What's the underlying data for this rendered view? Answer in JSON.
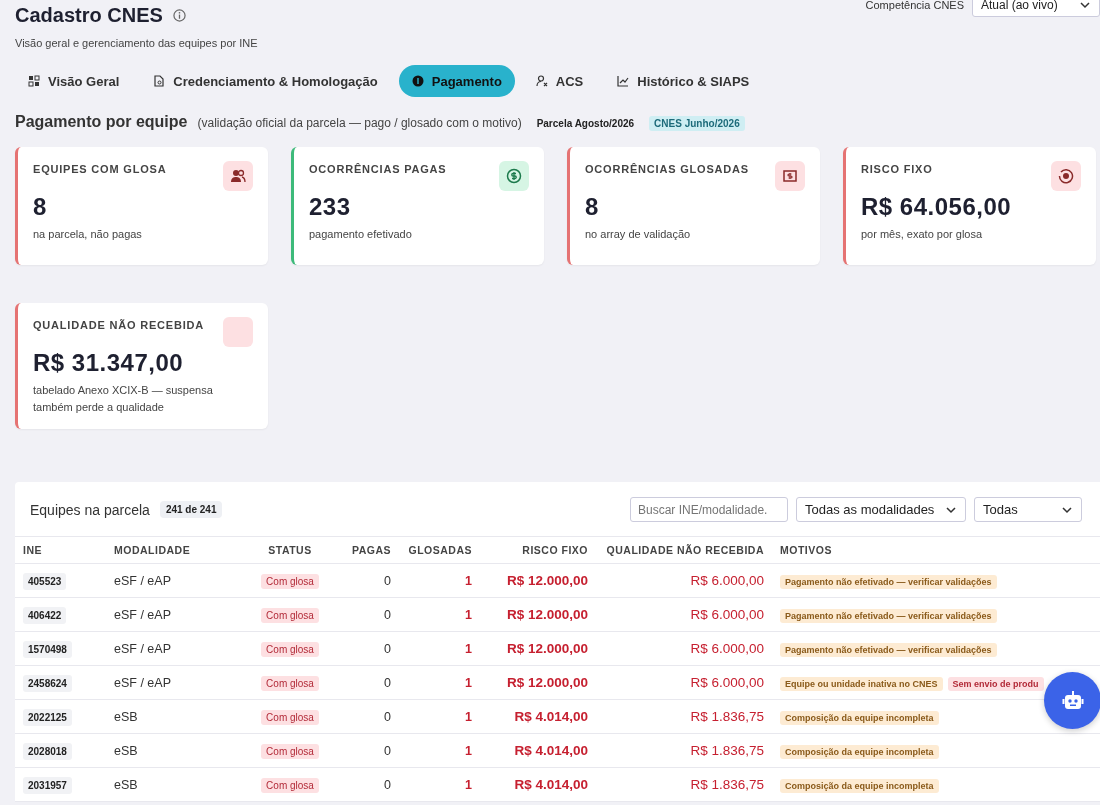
{
  "header": {
    "title": "Cadastro CNES",
    "subtitle": "Visão geral e gerenciamento das equipes por INE",
    "competencia_label": "Competência CNES",
    "competencia_value": "Atual (ao vivo)"
  },
  "tabs": [
    {
      "label": "Visão Geral",
      "selected": false
    },
    {
      "label": "Credenciamento & Homologação",
      "selected": false
    },
    {
      "label": "Pagamento",
      "selected": true
    },
    {
      "label": "ACS",
      "selected": false
    },
    {
      "label": "Histórico & SIAPS",
      "selected": false
    }
  ],
  "section": {
    "title": "Pagamento por equipe",
    "note": "(validação oficial da parcela — pago / glosado com o motivo)",
    "badges": [
      {
        "text": "Parcela Agosto/2026",
        "kind": "plain"
      },
      {
        "text": "CNES Junho/2026",
        "kind": "info"
      }
    ]
  },
  "cards": [
    {
      "label": "EQUIPES COM GLOSA",
      "value": "8",
      "caption": "na parcela, não pagas",
      "kind": "danger"
    },
    {
      "label": "OCORRÊNCIAS PAGAS",
      "value": "233",
      "caption": "pagamento efetivado",
      "kind": "success"
    },
    {
      "label": "OCORRÊNCIAS GLOSADAS",
      "value": "8",
      "caption": "no array de validação",
      "kind": "danger"
    },
    {
      "label": "RISCO FIXO",
      "value": "R$ 64.056,00",
      "caption": "por mês, exato por glosa",
      "kind": "danger"
    },
    {
      "label": "QUALIDADE NÃO RECEBIDA",
      "value": "R$ 31.347,00",
      "caption": "tabelado Anexo XCIX-B — suspensa também perde a qualidade",
      "kind": "danger"
    }
  ],
  "table": {
    "title": "Equipes na parcela",
    "count": "241 de 241",
    "search": {
      "placeholder": "Buscar INE/modalidade."
    },
    "filters": [
      "Todas as modalidades",
      "Todas"
    ],
    "columns": [
      "INE",
      "MODALIDADE",
      "STATUS",
      "PAGAS",
      "GLOSADAS",
      "RISCO FIXO",
      "QUALIDADE NÃO RECEBIDA",
      "MOTIVOS"
    ],
    "rows": [
      {
        "ine": "405523",
        "modalidade": "eSF / eAP",
        "status": "Com glosa",
        "pagas": "0",
        "glosadas": "1",
        "risco": "R$ 12.000,00",
        "qualidade": "R$ 6.000,00",
        "motivos": [
          {
            "text": "Pagamento não efetivado — verificar validações",
            "kind": "warning"
          }
        ]
      },
      {
        "ine": "406422",
        "modalidade": "eSF / eAP",
        "status": "Com glosa",
        "pagas": "0",
        "glosadas": "1",
        "risco": "R$ 12.000,00",
        "qualidade": "R$ 6.000,00",
        "motivos": [
          {
            "text": "Pagamento não efetivado — verificar validações",
            "kind": "warning"
          }
        ]
      },
      {
        "ine": "1570498",
        "modalidade": "eSF / eAP",
        "status": "Com glosa",
        "pagas": "0",
        "glosadas": "1",
        "risco": "R$ 12.000,00",
        "qualidade": "R$ 6.000,00",
        "motivos": [
          {
            "text": "Pagamento não efetivado — verificar validações",
            "kind": "warning"
          }
        ]
      },
      {
        "ine": "2458624",
        "modalidade": "eSF / eAP",
        "status": "Com glosa",
        "pagas": "0",
        "glosadas": "1",
        "risco": "R$ 12.000,00",
        "qualidade": "R$ 6.000,00",
        "motivos": [
          {
            "text": "Equipe ou unidade inativa no CNES",
            "kind": "warning"
          },
          {
            "text": "Sem envio de produ",
            "kind": "danger"
          }
        ]
      },
      {
        "ine": "2022125",
        "modalidade": "eSB",
        "status": "Com glosa",
        "pagas": "0",
        "glosadas": "1",
        "risco": "R$ 4.014,00",
        "qualidade": "R$ 1.836,75",
        "motivos": [
          {
            "text": "Composição da equipe incompleta",
            "kind": "warning"
          }
        ]
      },
      {
        "ine": "2028018",
        "modalidade": "eSB",
        "status": "Com glosa",
        "pagas": "0",
        "glosadas": "1",
        "risco": "R$ 4.014,00",
        "qualidade": "R$ 1.836,75",
        "motivos": [
          {
            "text": "Composição da equipe incompleta",
            "kind": "warning"
          }
        ]
      },
      {
        "ine": "2031957",
        "modalidade": "eSB",
        "status": "Com glosa",
        "pagas": "0",
        "glosadas": "1",
        "risco": "R$ 4.014,00",
        "qualidade": "R$ 1.836,75",
        "motivos": [
          {
            "text": "Composição da equipe incompleta",
            "kind": "warning"
          }
        ]
      }
    ]
  }
}
